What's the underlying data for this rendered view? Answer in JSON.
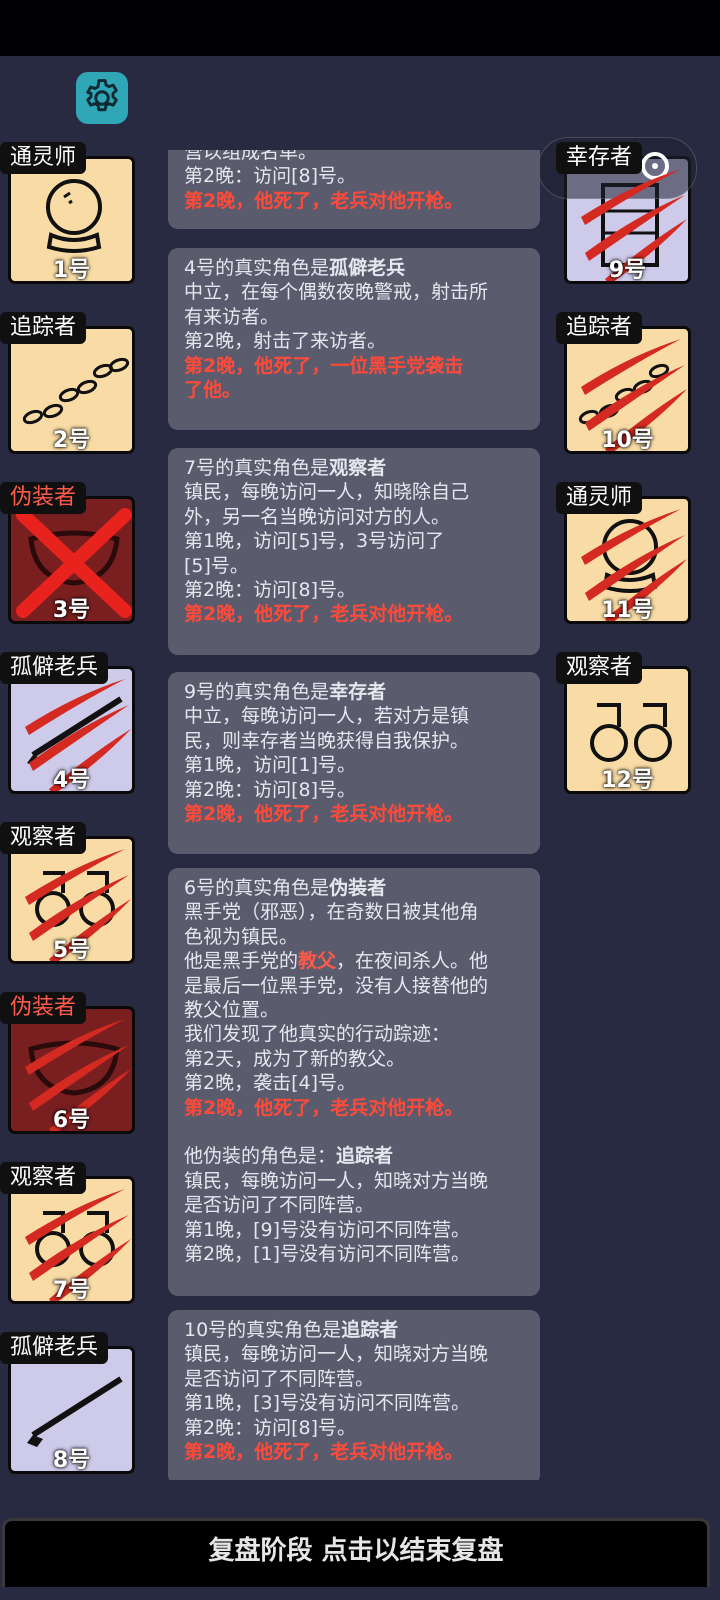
{
  "footer": {
    "label": "复盘阶段 点击以结束复盘"
  },
  "capsule": {
    "dots": "•••"
  },
  "colors": {
    "background": "#272a40",
    "gear": "#2fa7b6",
    "death_text": "#ff4a3a",
    "card_peach": "#f9dca5",
    "card_lavender": "#cdcaea",
    "card_dead_red": "#7a1f1f"
  },
  "players_left": [
    {
      "role": "通灵师",
      "num": "1号",
      "icon": "crystal-ball-icon",
      "dead": false
    },
    {
      "role": "追踪者",
      "num": "2号",
      "icon": "footprints-icon",
      "dead": false
    },
    {
      "role": "伪装者",
      "num": "3号",
      "icon": "mask-icon",
      "dead": "crossed"
    },
    {
      "role": "孤僻老兵",
      "num": "4号",
      "icon": "rifle-icon",
      "dead": "scratched"
    },
    {
      "role": "观察者",
      "num": "5号",
      "icon": "binoculars-icon",
      "dead": "scratched"
    },
    {
      "role": "伪装者",
      "num": "6号",
      "icon": "mask-icon",
      "dead": "scratched"
    },
    {
      "role": "观察者",
      "num": "7号",
      "icon": "binoculars-icon",
      "dead": "scratched"
    },
    {
      "role": "孤僻老兵",
      "num": "8号",
      "icon": "rifle-icon",
      "dead": false
    }
  ],
  "players_right": [
    {
      "role": "幸存者",
      "num": "9号",
      "icon": "vest-icon",
      "dead": "scratched"
    },
    {
      "role": "追踪者",
      "num": "10号",
      "icon": "footprints-icon",
      "dead": "scratched"
    },
    {
      "role": "通灵师",
      "num": "11号",
      "icon": "crystal-ball-icon",
      "dead": "scratched"
    },
    {
      "role": "观察者",
      "num": "12号",
      "icon": "binoculars-icon",
      "dead": false
    }
  ],
  "log": {
    "e0": {
      "l1": "营以组成名单。",
      "l2": "第2晚：访问[8]号。",
      "death": "第2晚，他死了，老兵对他开枪。"
    },
    "e1": {
      "head": "4号的真实角色是",
      "role": "孤僻老兵",
      "l1": "中立，在每个偶数夜晚警戒，射击所",
      "l2": "有来访者。",
      "l3": "第2晚，射击了来访者。",
      "death1": "第2晚，他死了，一位黑手党袭击",
      "death2": "了他。"
    },
    "e2": {
      "head": "7号的真实角色是",
      "role": "观察者",
      "l1": "镇民，每晚访问一人，知晓除自己",
      "l2": "外，另一名当晚访问对方的人。",
      "l3": "第1晚，访问[5]号，3号访问了",
      "l4": "[5]号。",
      "l5": "第2晚：访问[8]号。",
      "death": "第2晚，他死了，老兵对他开枪。"
    },
    "e3": {
      "head": "9号的真实角色是",
      "role": "幸存者",
      "l1": "中立，每晚访问一人，若对方是镇",
      "l2": "民，则幸存者当晚获得自我保护。",
      "l3": "第1晚，访问[1]号。",
      "l4": "第2晚：访问[8]号。",
      "death": "第2晚，他死了，老兵对他开枪。"
    },
    "e4": {
      "head": "6号的真实角色是",
      "role": "伪装者",
      "l1": "黑手党（邪恶），在奇数日被其他角",
      "l2": "色视为镇民。",
      "l3a": "他是黑手党的",
      "l3kw": "教父",
      "l3b": "，在夜间杀人。他",
      "l4": "是最后一位黑手党，没有人接替他的",
      "l5": "教父位置。",
      "l6": "我们发现了他真实的行动踪迹：",
      "l7": "第2天，成为了新的教父。",
      "l8": "第2晚，袭击[4]号。",
      "death": "第2晚，他死了，老兵对他开枪。",
      "fake_head": "他伪装的角色是：",
      "fake_role": "追踪者",
      "f1": "镇民，每晚访问一人，知晓对方当晚",
      "f2": "是否访问了不同阵营。",
      "f3": "第1晚，[9]号没有访问不同阵营。",
      "f4": "第2晚，[1]号没有访问不同阵营。"
    },
    "e5": {
      "head": "10号的真实角色是",
      "role": "追踪者",
      "l1": "镇民，每晚访问一人，知晓对方当晚",
      "l2": "是否访问了不同阵营。",
      "l3": "第1晚，[3]号没有访问不同阵营。",
      "l4": "第2晚：访问[8]号。",
      "death": "第2晚，他死了，老兵对他开枪。"
    }
  }
}
